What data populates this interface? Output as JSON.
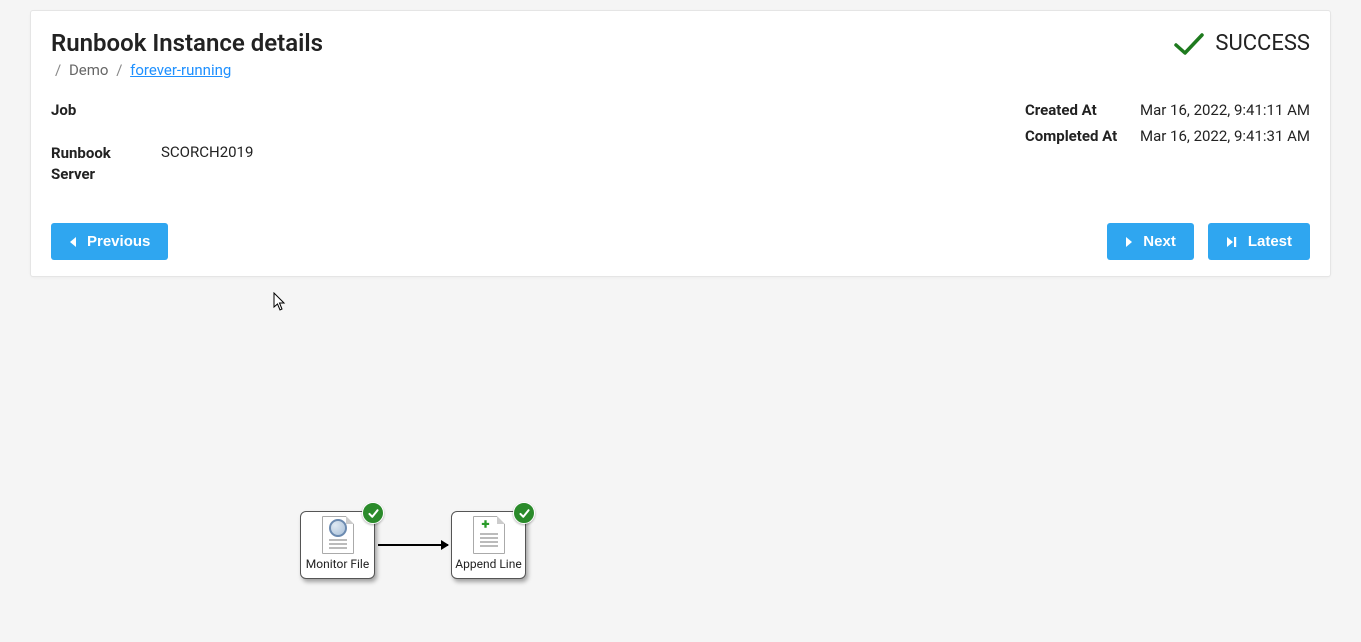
{
  "header": {
    "title": "Runbook Instance details",
    "breadcrumb": {
      "root_sep": "/",
      "folder": "Demo",
      "sep": "/",
      "runbook": "forever-running"
    },
    "status": {
      "label": "SUCCESS"
    }
  },
  "details": {
    "job_label": "Job",
    "job_value": "",
    "server_label_line1": "Runbook",
    "server_label_line2": "Server",
    "server_value": "SCORCH2019",
    "created_label": "Created At",
    "created_value": "Mar 16, 2022, 9:41:11 AM",
    "completed_label": "Completed At",
    "completed_value": "Mar 16, 2022, 9:41:31 AM"
  },
  "buttons": {
    "previous": "Previous",
    "next": "Next",
    "latest": "Latest"
  },
  "workflow": {
    "activity1": {
      "label": "Monitor File"
    },
    "activity2": {
      "label": "Append Line"
    }
  }
}
